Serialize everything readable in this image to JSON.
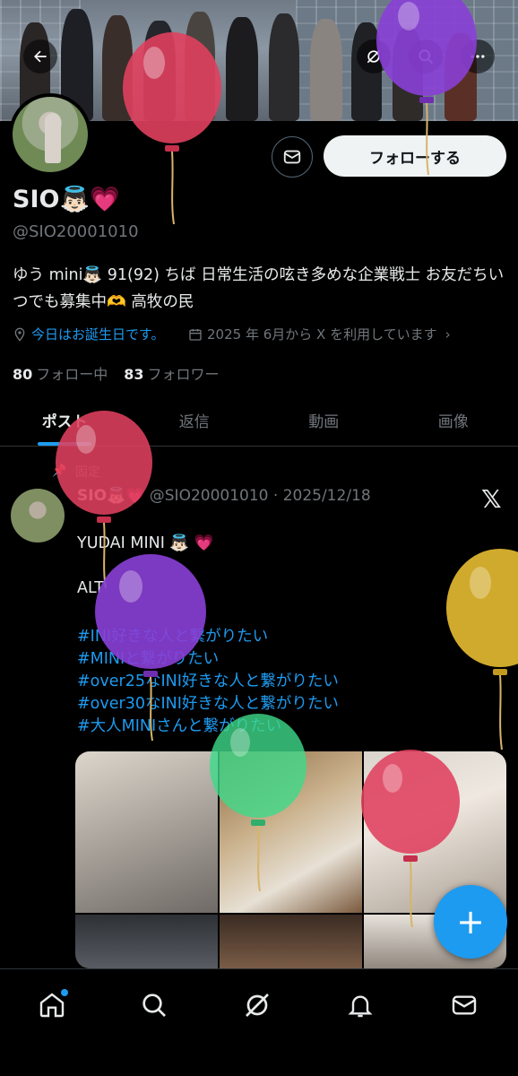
{
  "profile": {
    "name": "SIO👼🏻💗",
    "handle": "@SIO20001010",
    "bio": "ゆう mini👼🏻 91(92) ちば 日常生活の呟き多めな企業戦士 お友だちいつでも募集中🫶 高牧の民",
    "birthday_text": "今日はお誕生日です。",
    "joined_text": "2025 年 6月から X を利用しています",
    "following_count": "80",
    "following_label": "フォロー中",
    "followers_count": "83",
    "followers_label": "フォロワー"
  },
  "actions": {
    "follow_label": "フォローする"
  },
  "tabs": [
    "ポスト",
    "返信",
    "動画",
    "画像"
  ],
  "post": {
    "pinned_label": "固定",
    "name": "SIO👼🏻💗",
    "meta": "@SIO20001010 · 2025/12/18",
    "line1": "YUDAI MINI 👼🏻 💗",
    "line2": "ALT",
    "tags": [
      "#INI好きな人と繋がりたい",
      "#MINIと繋がりたい",
      "#over25なINI好きな人と繋がりたい",
      "#over30なINI好きな人と繋がりたい",
      "#大人MINIさんと繋がりたい"
    ]
  },
  "colors": {
    "accent": "#1d9bf0",
    "background": "#000000",
    "muted": "#71767b"
  },
  "icons": {
    "back": "arrow-left-icon",
    "grok": "grok-icon",
    "search": "search-icon",
    "more": "more-icon",
    "message": "envelope-icon",
    "nav": [
      "home-icon",
      "search-icon",
      "grok-icon",
      "bell-icon",
      "envelope-icon"
    ]
  }
}
